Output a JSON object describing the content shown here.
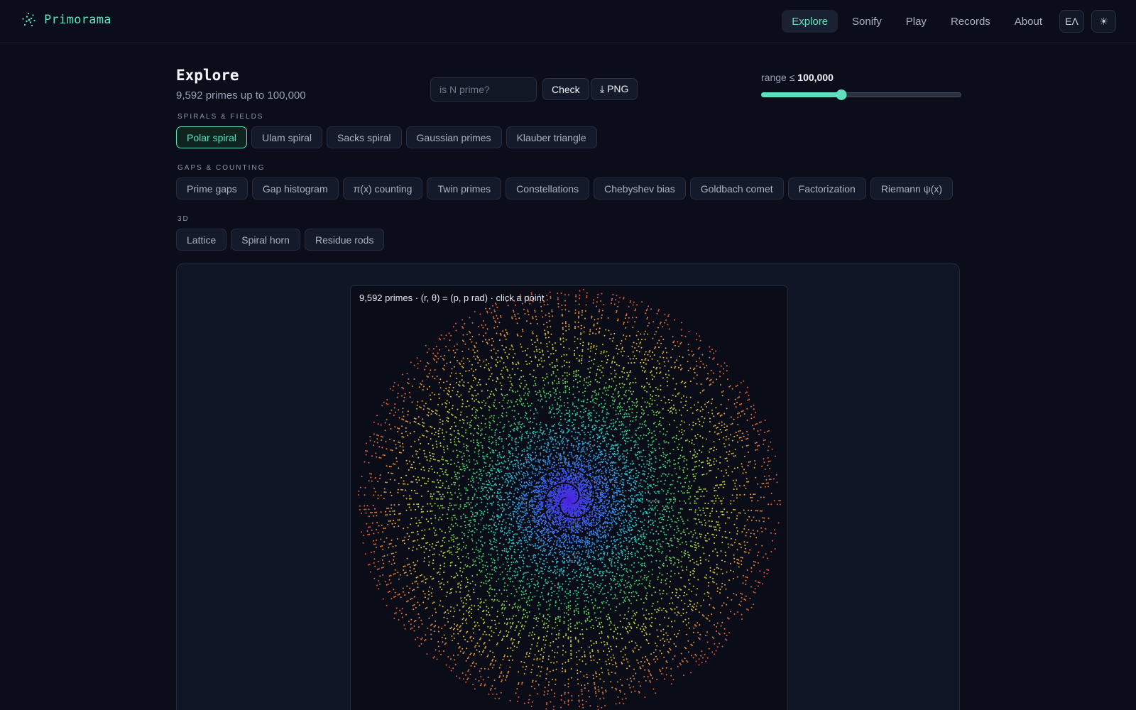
{
  "brand": {
    "name": "Primorama",
    "logo_icon": "dotted-spiral-icon",
    "accent": "#5fe0bd"
  },
  "nav": {
    "items": [
      {
        "label": "Explore",
        "active": true
      },
      {
        "label": "Sonify",
        "active": false
      },
      {
        "label": "Play",
        "active": false
      },
      {
        "label": "Records",
        "active": false
      },
      {
        "label": "About",
        "active": false
      }
    ],
    "language_label": "ΕΛ",
    "theme_icon": "sun-icon",
    "theme_glyph": "☀"
  },
  "header": {
    "title": "Explore",
    "subtitle": "9,592 primes up to 100,000"
  },
  "prime_check": {
    "placeholder": "is N prime?",
    "value": "",
    "check_label": "Check",
    "png_label": "⤓ PNG"
  },
  "range": {
    "label_prefix": "range ≤ ",
    "value_label": "100,000",
    "fraction": 0.4
  },
  "groups": [
    {
      "label": "SPIRALS & FIELDS",
      "items": [
        {
          "label": "Polar spiral",
          "active": true
        },
        {
          "label": "Ulam spiral",
          "active": false
        },
        {
          "label": "Sacks spiral",
          "active": false
        },
        {
          "label": "Gaussian primes",
          "active": false
        },
        {
          "label": "Klauber triangle",
          "active": false
        }
      ]
    },
    {
      "label": "GAPS & COUNTING",
      "items": [
        {
          "label": "Prime gaps",
          "active": false
        },
        {
          "label": "Gap histogram",
          "active": false
        },
        {
          "label": "π(x) counting",
          "active": false
        },
        {
          "label": "Twin primes",
          "active": false
        },
        {
          "label": "Constellations",
          "active": false
        },
        {
          "label": "Chebyshev bias",
          "active": false
        },
        {
          "label": "Goldbach comet",
          "active": false
        },
        {
          "label": "Factorization",
          "active": false
        },
        {
          "label": "Riemann ψ(x)",
          "active": false
        }
      ]
    },
    {
      "label": "3D",
      "items": [
        {
          "label": "Lattice",
          "active": false
        },
        {
          "label": "Spiral horn",
          "active": false
        },
        {
          "label": "Residue rods",
          "active": false
        }
      ]
    }
  ],
  "visualization": {
    "caption": "9,592 primes · (r, θ) = (p, p rad) · click a point",
    "prime_limit": 100000,
    "point_colors": [
      "#4a1fe0",
      "#3f7bff",
      "#2fc7c9",
      "#3fd36b",
      "#c9e23a",
      "#f0a93a",
      "#e4553f"
    ]
  }
}
